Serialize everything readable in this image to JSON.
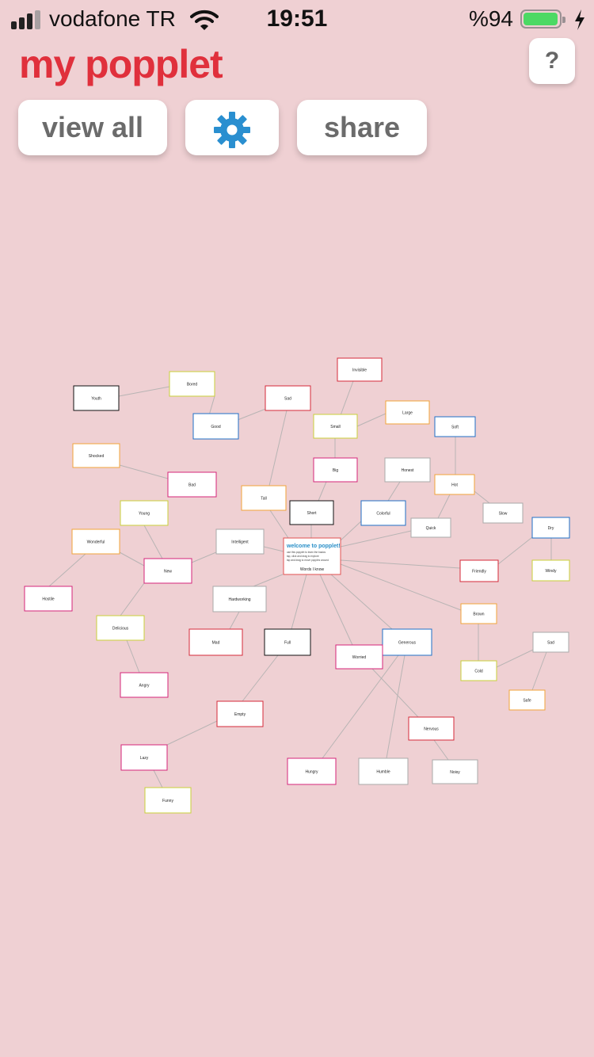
{
  "status_bar": {
    "carrier": "vodafone TR",
    "time": "19:51",
    "battery_percent": "%94",
    "battery_level": 0.94
  },
  "header": {
    "app_title": "my popplet",
    "help_label": "?"
  },
  "toolbar": {
    "view_all_label": "view all",
    "settings_icon": "gear-icon",
    "share_label": "share"
  },
  "colors": {
    "title_red": "#e0303c",
    "gear_blue": "#2a8fd0",
    "background": "#efd0d3"
  },
  "map": {
    "welcome": {
      "title": "welcome to popplet!",
      "lines": [
        "use this popplet to learn the basics",
        "tap, click and drag to explore",
        "tap and drag to move popples around"
      ],
      "footer": "Words I know"
    },
    "popples": [
      {
        "id": "p1",
        "label": "Invisible"
      },
      {
        "id": "p2",
        "label": "Youth"
      },
      {
        "id": "p3",
        "label": "Bored"
      },
      {
        "id": "p4",
        "label": "Sad"
      },
      {
        "id": "p5",
        "label": "Good"
      },
      {
        "id": "p6",
        "label": "Small"
      },
      {
        "id": "p7",
        "label": "Large"
      },
      {
        "id": "p8",
        "label": "Soft"
      },
      {
        "id": "p9",
        "label": "Shocked"
      },
      {
        "id": "p10",
        "label": "Bad"
      },
      {
        "id": "p11",
        "label": "Big"
      },
      {
        "id": "p12",
        "label": "Honest"
      },
      {
        "id": "p13",
        "label": "Tall"
      },
      {
        "id": "p14",
        "label": "Short"
      },
      {
        "id": "p15",
        "label": "Colorful"
      },
      {
        "id": "p16",
        "label": "Hot"
      },
      {
        "id": "p17",
        "label": "Young"
      },
      {
        "id": "p18",
        "label": "Quick"
      },
      {
        "id": "p19",
        "label": "Slow"
      },
      {
        "id": "p20",
        "label": "Wonderful"
      },
      {
        "id": "p21",
        "label": "Intelligent"
      },
      {
        "id": "p22",
        "label": "Dry"
      },
      {
        "id": "p23",
        "label": "New"
      },
      {
        "id": "p24",
        "label": "Friendly"
      },
      {
        "id": "p25",
        "label": "Windy"
      },
      {
        "id": "p26",
        "label": "Hostile"
      },
      {
        "id": "p27",
        "label": "Hardworking"
      },
      {
        "id": "p28",
        "label": "Brown"
      },
      {
        "id": "p29",
        "label": "Delicious"
      },
      {
        "id": "p30",
        "label": "Mad"
      },
      {
        "id": "p31",
        "label": "Full"
      },
      {
        "id": "p32",
        "label": "Generous"
      },
      {
        "id": "p33",
        "label": "Worried"
      },
      {
        "id": "p34",
        "label": "Sad"
      },
      {
        "id": "p35",
        "label": "Cold"
      },
      {
        "id": "p36",
        "label": "Angry"
      },
      {
        "id": "p37",
        "label": "Safe"
      },
      {
        "id": "p38",
        "label": "Empty"
      },
      {
        "id": "p39",
        "label": "Nervous"
      },
      {
        "id": "p40",
        "label": "Lazy"
      },
      {
        "id": "p41",
        "label": "Hungry"
      },
      {
        "id": "p42",
        "label": "Humble"
      },
      {
        "id": "p43",
        "label": "Noisy"
      },
      {
        "id": "p44",
        "label": "Funny"
      }
    ]
  }
}
